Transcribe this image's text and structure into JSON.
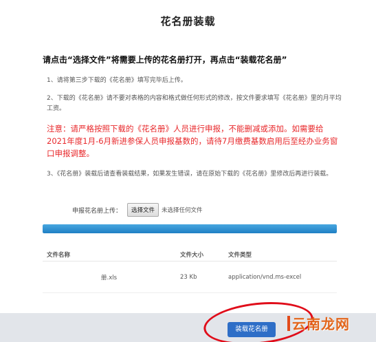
{
  "page": {
    "title": "花名册装载"
  },
  "instructions": {
    "heading": "请点击“选择文件”将需要上传的花名册打开，再点击“装载花名册”",
    "steps": [
      "1、请将第三步下载的《花名册》填写完毕后上传。",
      "2、下载的《花名册》请不要对表格的内容和格式做任何形式的修改，按文件要求填写《花名册》里的月平均工资。",
      "注意：请严格按照下载的《花名册》人员进行申报，不能删减或添加。如需要给2021年度1月-6月新进参保人员申报基数的，请待7月缴费基数启用后至经办业务窗口申报调整。",
      "3、《花名册》装载后请查看装载结果，如果发生错误，请在原始下载的《花名册》里修改后再进行装载。"
    ]
  },
  "upload": {
    "label": "申报花名册上传：",
    "choose_button": "选择文件",
    "status": "未选择任何文件"
  },
  "progress": {
    "fraction": 1.0
  },
  "file_table": {
    "headers": [
      "文件名称",
      "文件大小",
      "文件类型"
    ],
    "rows": [
      {
        "name": "册.xls",
        "size": "23 Kb",
        "type": "application/vnd.ms-excel"
      }
    ]
  },
  "footer": {
    "submit_button": "装载花名册"
  },
  "watermark": {
    "text": "云南龙网"
  },
  "colors": {
    "warning": "#e8282b",
    "accent": "#2e6ec7",
    "highlight": "#e00d1a"
  }
}
